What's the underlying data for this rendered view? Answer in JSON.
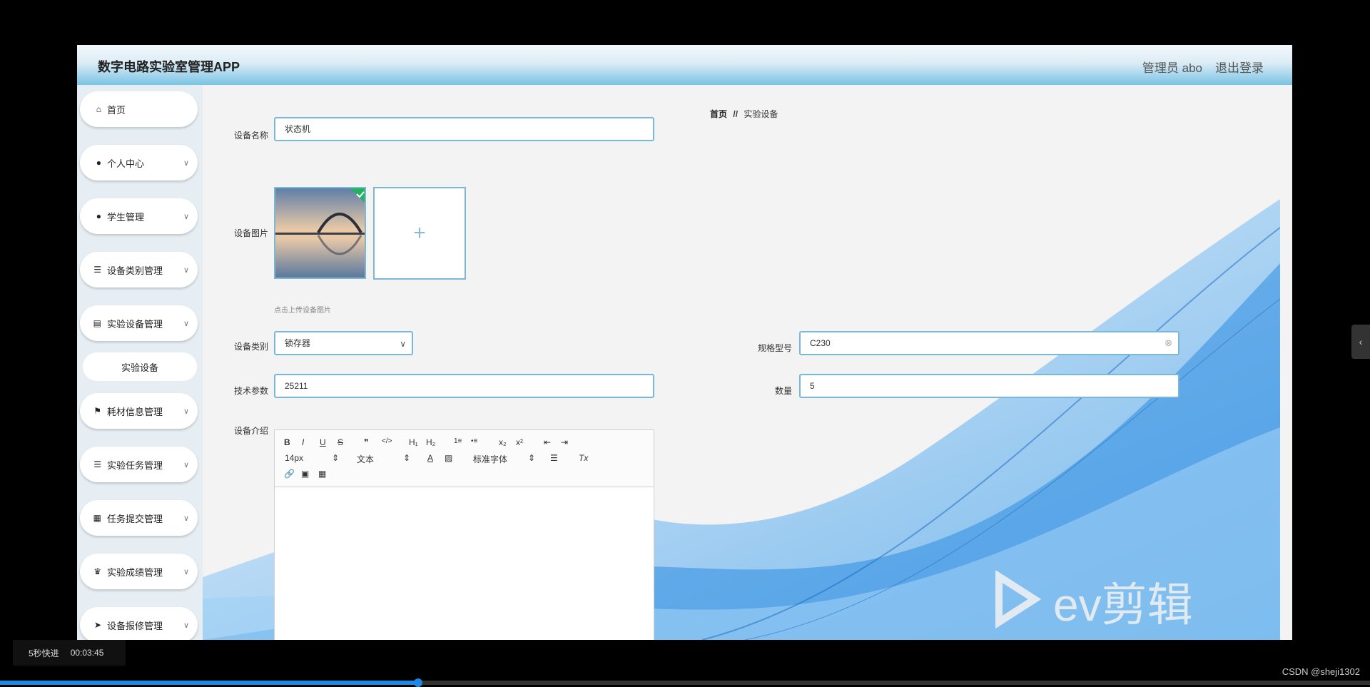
{
  "header": {
    "app_title": "数字电路实验室管理APP",
    "user": "管理员 abo",
    "logout": "退出登录"
  },
  "sidebar": {
    "items": [
      {
        "label": "首页",
        "icon": "home-icon"
      },
      {
        "label": "个人中心",
        "icon": "user-icon"
      },
      {
        "label": "学生管理",
        "icon": "user-icon"
      },
      {
        "label": "设备类别管理",
        "icon": "list-icon"
      },
      {
        "label": "实验设备管理",
        "icon": "clipboard-icon"
      },
      {
        "label": "耗材信息管理",
        "icon": "flag-icon"
      },
      {
        "label": "实验任务管理",
        "icon": "list-icon"
      },
      {
        "label": "任务提交管理",
        "icon": "grid-icon"
      },
      {
        "label": "实验成绩管理",
        "icon": "trophy-icon"
      },
      {
        "label": "设备报修管理",
        "icon": "send-icon"
      }
    ],
    "subitem": "实验设备"
  },
  "breadcrumb": {
    "home": "首页",
    "separator": "//",
    "current": "实验设备"
  },
  "form": {
    "name_label": "设备名称",
    "name_value": "状态机",
    "image_label": "设备图片",
    "upload_hint": "点击上传设备图片",
    "upload_plus": "+",
    "category_label": "设备类别",
    "category_value": "锁存器",
    "model_label": "规格型号",
    "model_value": "C230",
    "tech_label": "技术参数",
    "tech_value": "25211",
    "qty_label": "数量",
    "qty_value": "5",
    "intro_label": "设备介绍"
  },
  "editor_toolbar": {
    "bold": "B",
    "italic": "I",
    "underline": "U",
    "strike": "S",
    "quote": "❞",
    "code": "</>",
    "h1": "H₁",
    "h2": "H₂",
    "ordered": "1≡",
    "bullet": "•≡",
    "sub": "x₂",
    "sup": "x²",
    "outdent": "⇤",
    "indent": "⇥",
    "size": "14px",
    "header": "文本",
    "font": "标准字体",
    "color": "A",
    "clean": "Tx"
  },
  "video_overlay": {
    "speed": "5秒快进",
    "time": "00:03:45",
    "progress": 0.305,
    "watermark": "CSDN @sheji1302",
    "ev_text": "ev剪辑"
  },
  "colors": {
    "accent": "#7ab8d5",
    "header_bottom": "#79c3e4",
    "wave": "#2a8ae0"
  }
}
